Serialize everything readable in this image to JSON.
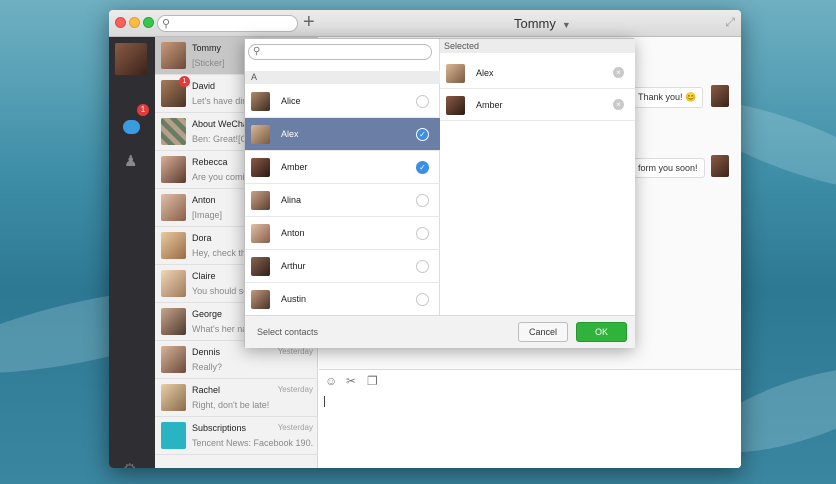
{
  "window": {
    "title": "Tommy"
  },
  "sidebar": {
    "chat_badge": "1"
  },
  "conversations": [
    {
      "name": "Tommy",
      "message": "[Sticker]",
      "time": "",
      "badge": ""
    },
    {
      "name": "David",
      "message": "Let's have dinner",
      "time": "",
      "badge": "1"
    },
    {
      "name": "About WeChat",
      "message": "Ben: Great![Grin]",
      "time": "",
      "badge": ""
    },
    {
      "name": "Rebecca",
      "message": "Are you coming?",
      "time": "",
      "badge": ""
    },
    {
      "name": "Anton",
      "message": "[Image]",
      "time": "",
      "badge": ""
    },
    {
      "name": "Dora",
      "message": "Hey, check this out",
      "time": "",
      "badge": ""
    },
    {
      "name": "Claire",
      "message": "You should see this",
      "time": "",
      "badge": ""
    },
    {
      "name": "George",
      "message": "What's her name?",
      "time": "",
      "badge": ""
    },
    {
      "name": "Dennis",
      "message": "Really?",
      "time": "Yesterday",
      "badge": ""
    },
    {
      "name": "Rachel",
      "message": "Right, don't be late!",
      "time": "Yesterday",
      "badge": ""
    },
    {
      "name": "Subscriptions",
      "message": "Tencent News: Facebook 190...",
      "time": "Yesterday",
      "badge": ""
    }
  ],
  "chat": {
    "bubble1": "Thank you! 😊",
    "bubble2": "form you soon!"
  },
  "dialog": {
    "section_letter": "A",
    "selected_header": "Selected",
    "contacts": [
      {
        "name": "Alice",
        "checked": false
      },
      {
        "name": "Alex",
        "checked": true
      },
      {
        "name": "Amber",
        "checked": true
      },
      {
        "name": "Alina",
        "checked": false
      },
      {
        "name": "Anton",
        "checked": false
      },
      {
        "name": "Arthur",
        "checked": false
      },
      {
        "name": "Austin",
        "checked": false
      }
    ],
    "selected": [
      {
        "name": "Alex"
      },
      {
        "name": "Amber"
      }
    ],
    "footer_hint": "Select contacts",
    "cancel_label": "Cancel",
    "ok_label": "OK",
    "check_glyph": "✓",
    "remove_glyph": "×"
  },
  "colors": {
    "accent_green": "#2fb33a",
    "selection_row": "#6b7ea5",
    "check_blue": "#3b8fe4",
    "badge_red": "#e5393b"
  }
}
